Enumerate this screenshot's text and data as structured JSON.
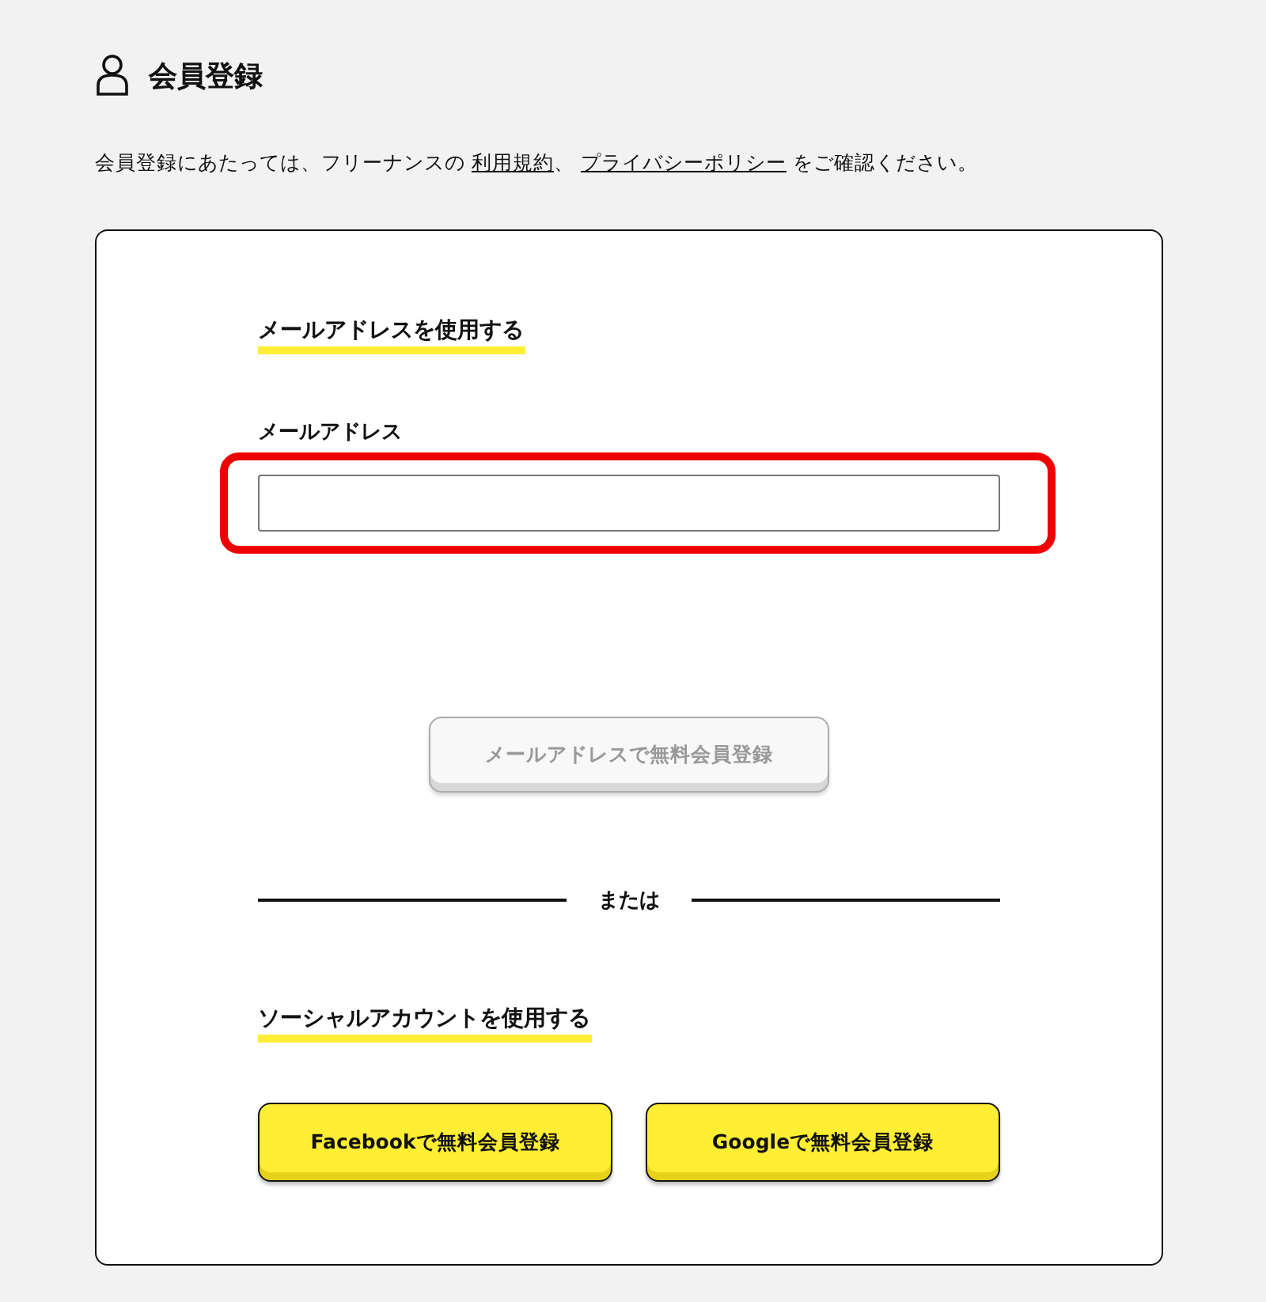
{
  "header": {
    "title": "会員登録"
  },
  "intro": {
    "parts": [
      {
        "kind": "text",
        "text": "会員登録にあたっては、フリーナンスの "
      },
      {
        "kind": "link",
        "text": "利用規約"
      },
      {
        "kind": "text",
        "text": "、 "
      },
      {
        "kind": "link",
        "text": "プライバシーポリシー"
      },
      {
        "kind": "text",
        "text": " をご確認ください。"
      }
    ]
  },
  "email_section": {
    "heading": "メールアドレスを使用する",
    "field_label": "メールアドレス",
    "field_highlighted": true,
    "submit": {
      "label": "メールアドレスで無料会員登録",
      "disabled": true
    }
  },
  "divider_text": "または",
  "social_section": {
    "heading": "ソーシャルアカウントを使用する",
    "buttons": [
      {
        "label": "Facebookで無料会員登録",
        "disabled": false
      },
      {
        "label": "Googleで無料会員登録",
        "disabled": false
      }
    ]
  }
}
